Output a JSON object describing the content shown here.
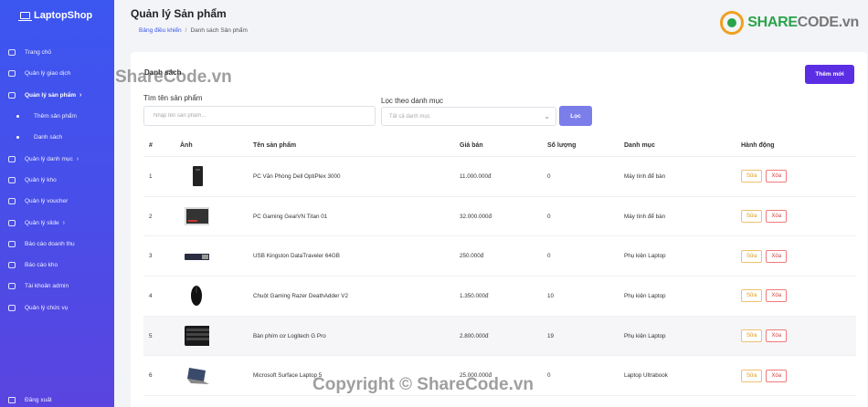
{
  "sidebar": {
    "brand": "LaptopShop",
    "items": [
      {
        "label": "Trang chủ",
        "type": "item"
      },
      {
        "label": "Quản lý giao dịch",
        "type": "item"
      },
      {
        "label": "Quản lý sản phẩm",
        "type": "item",
        "chevron": "›",
        "active": true
      },
      {
        "label": "Thêm sản phẩm",
        "type": "sub"
      },
      {
        "label": "Danh sách",
        "type": "sub"
      },
      {
        "label": "Quản lý danh mục",
        "type": "item",
        "chevron": "›"
      },
      {
        "label": "Quản lý kho",
        "type": "item"
      },
      {
        "label": "Quản lý voucher",
        "type": "item"
      },
      {
        "label": "Quản lý slide",
        "type": "item",
        "chevron": "›"
      },
      {
        "label": "Báo cáo doanh thu",
        "type": "item"
      },
      {
        "label": "Báo cáo kho",
        "type": "item"
      },
      {
        "label": "Tài khoản admin",
        "type": "item"
      },
      {
        "label": "Quản lý chức vụ",
        "type": "item"
      }
    ],
    "logout": "Đăng xuất"
  },
  "header": {
    "title": "Quản lý Sản phẩm",
    "breadcrumb": {
      "home": "Bảng điều khiển",
      "separator": "/",
      "current": "Danh sách Sản phẩm"
    }
  },
  "logo": {
    "brand_main": "SHARE",
    "brand_rest": "CODE.vn"
  },
  "card": {
    "heading": "Danh sách",
    "add_button": "Thêm mới",
    "search": {
      "label": "Tìm tên sản phẩm",
      "placeholder": "Nhập tên sản phẩm..."
    },
    "category_filter": {
      "label": "Lọc theo danh mục",
      "selected": "Tất cả danh mục"
    },
    "filter_button": "Lọc"
  },
  "table": {
    "columns": [
      "#",
      "Ảnh",
      "Tên sản phẩm",
      "Giá bán",
      "Số lượng",
      "Danh mục",
      "Hành động"
    ],
    "edit_label": "Sửa",
    "delete_label": "Xóa",
    "rows": [
      {
        "idx": "1",
        "name": "PC Văn Phòng Dell OptiPlex 3000",
        "price": "11.000.000đ",
        "qty": "0",
        "category": "Máy tính để bàn",
        "thumb": "pc-tower"
      },
      {
        "idx": "2",
        "name": "PC Gaming GearVN Titan 01",
        "price": "32.000.000đ",
        "qty": "0",
        "category": "Máy tính để bàn",
        "thumb": "pc-gaming"
      },
      {
        "idx": "3",
        "name": "USB Kingston DataTraveler 64GB",
        "price": "250.000đ",
        "qty": "0",
        "category": "Phụ kiện Laptop",
        "thumb": "usb"
      },
      {
        "idx": "4",
        "name": "Chuột Gaming Razer DeathAdder V2",
        "price": "1.350.000đ",
        "qty": "10",
        "category": "Phụ kiện Laptop",
        "thumb": "mouse"
      },
      {
        "idx": "5",
        "name": "Bàn phím cơ Logitech G Pro",
        "price": "2.800.000đ",
        "qty": "19",
        "category": "Phụ kiện Laptop",
        "thumb": "keyboard"
      },
      {
        "idx": "6",
        "name": "Microsoft Surface Laptop 5",
        "price": "25.000.000đ",
        "qty": "0",
        "category": "Laptop Ultrabook",
        "thumb": "laptop"
      }
    ]
  },
  "watermarks": {
    "top": "ShareCode.vn",
    "bottom": "Copyright © ShareCode.vn"
  }
}
